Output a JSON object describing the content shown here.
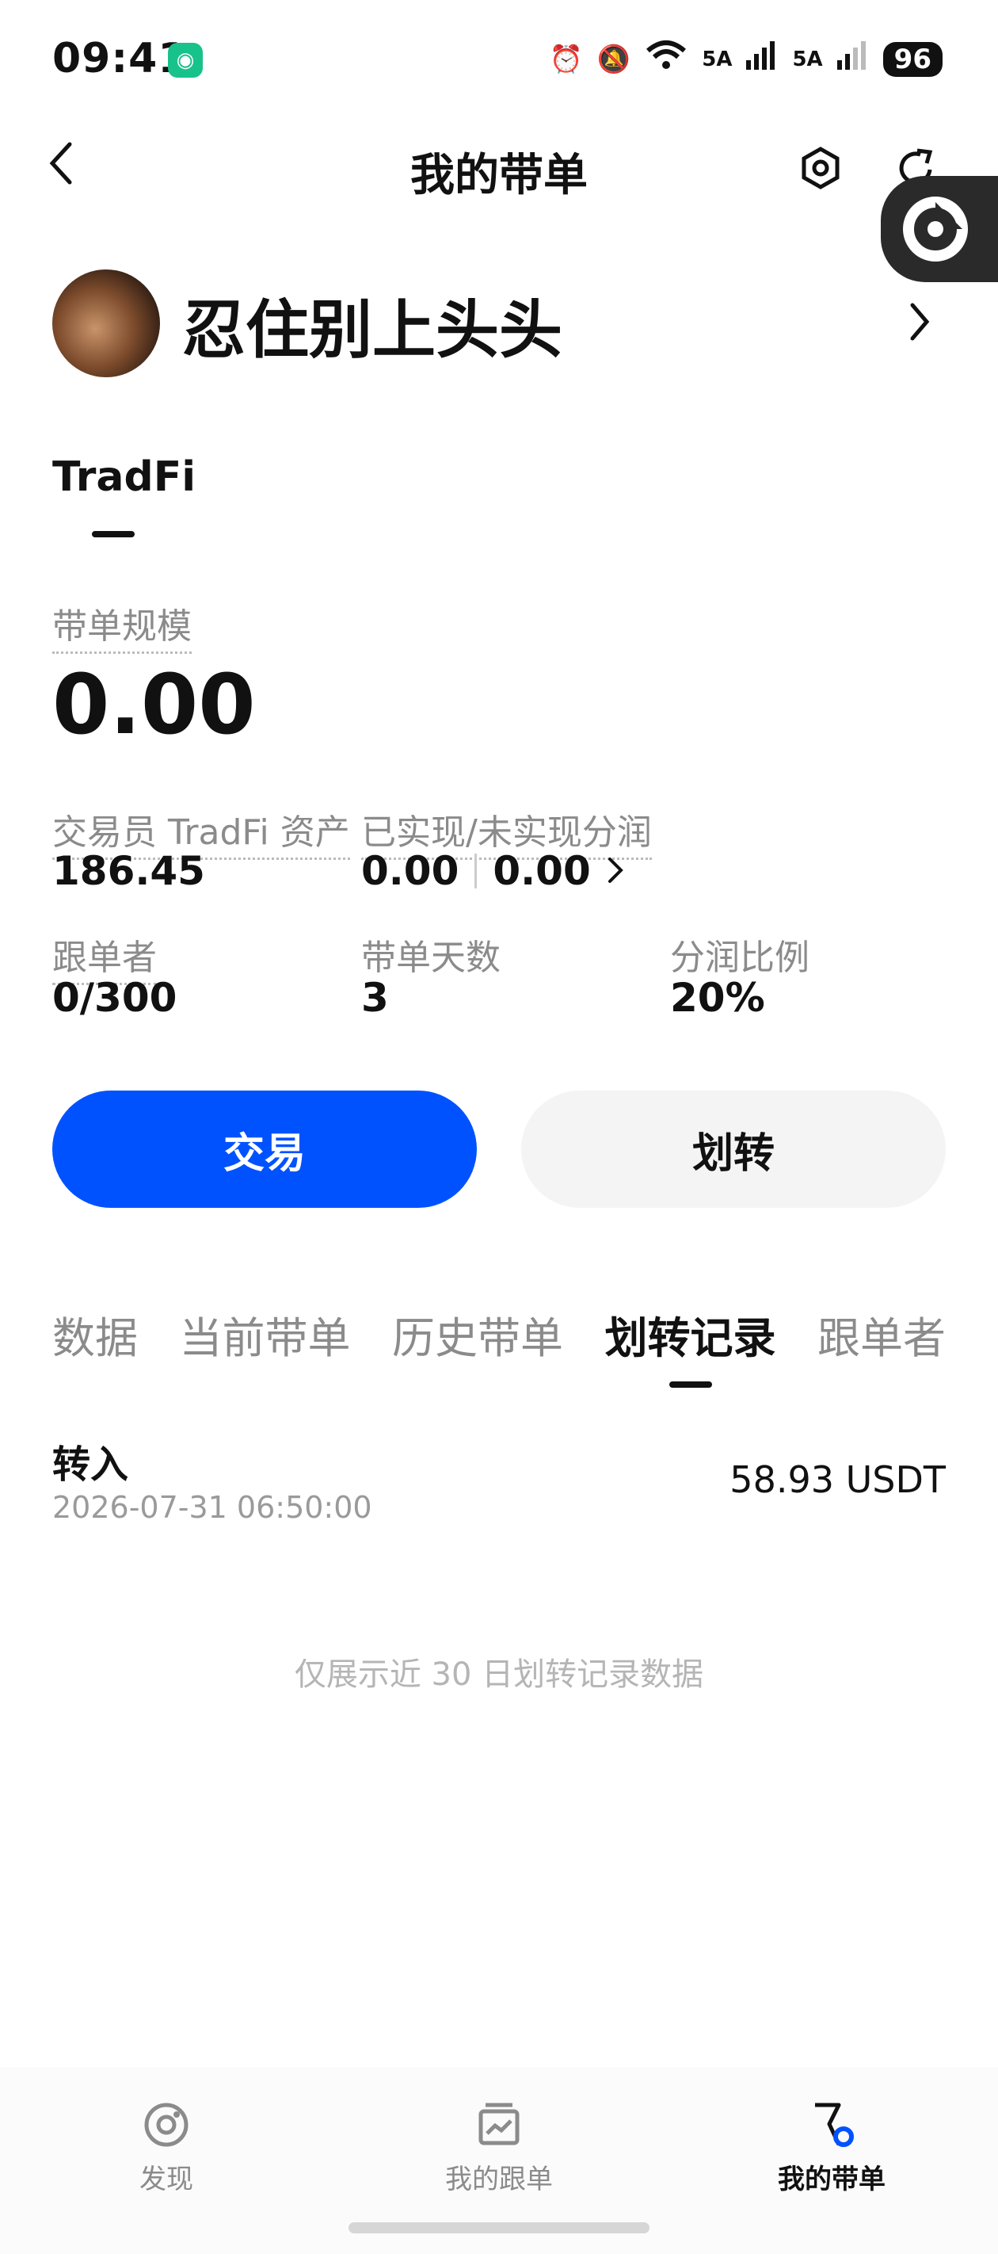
{
  "status_bar": {
    "time": "09:41",
    "battery": "96",
    "signal1": "5A",
    "signal2": "5A",
    "wifi_tag": "6"
  },
  "nav": {
    "title": "我的带单"
  },
  "profile": {
    "name": "忍住别上头头"
  },
  "category_tab": "TradFi",
  "scale": {
    "label": "带单规模",
    "value": "0.00"
  },
  "metrics": {
    "assets_label": "交易员 TradFi 资产",
    "assets_value": "186.45",
    "pnl_label": "已实现/未实现分润",
    "realized": "0.00",
    "unrealized": "0.00",
    "followers_label": "跟单者",
    "followers_value": "0/300",
    "days_label": "带单天数",
    "days_value": "3",
    "share_label": "分润比例",
    "share_value": "20%"
  },
  "buttons": {
    "trade": "交易",
    "transfer": "划转"
  },
  "subtabs": [
    "数据",
    "当前带单",
    "历史带单",
    "划转记录",
    "跟单者"
  ],
  "active_subtab": "划转记录",
  "record": {
    "type": "转入",
    "time": "2026-07-31 06:50:00",
    "amount": "58.93 USDT"
  },
  "note": "仅展示近 30 日划转记录数据",
  "bottom_nav": [
    {
      "label": "发现",
      "icon": "discover-icon"
    },
    {
      "label": "我的跟单",
      "icon": "chart-icon"
    },
    {
      "label": "我的带单",
      "icon": "flag-icon"
    }
  ],
  "colors": {
    "primary": "#0052ff",
    "text": "#111111",
    "muted": "#8b8b8b"
  }
}
